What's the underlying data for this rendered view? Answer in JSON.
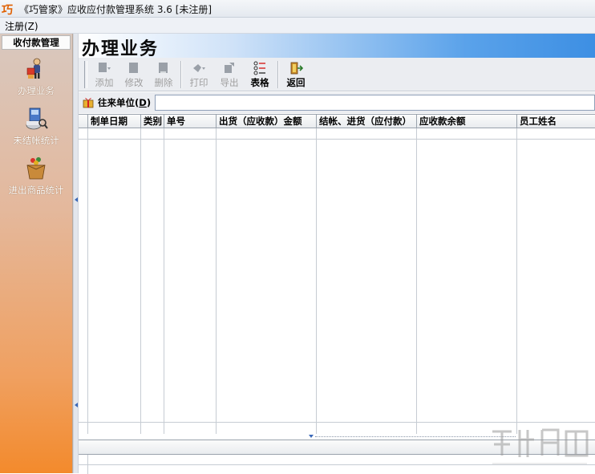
{
  "window": {
    "logo": "巧",
    "title": "《巧管家》应收应付款管理系统 3.6 [未注册]"
  },
  "menu": {
    "register": "注册(Z)"
  },
  "sidebar": {
    "header": "收付款管理",
    "items": [
      {
        "label": "办理业务",
        "icon": "business-person-icon"
      },
      {
        "label": "未结帐统计",
        "icon": "unsettled-stats-icon"
      },
      {
        "label": "进出商品统计",
        "icon": "goods-box-icon"
      }
    ]
  },
  "page": {
    "title": "办理业务"
  },
  "toolbar": {
    "add": "添加",
    "edit": "修改",
    "delete": "删除",
    "print": "打印",
    "export": "导出",
    "table": "表格",
    "back": "返回"
  },
  "filter": {
    "partner_label_main": "往来单位",
    "partner_label_key": "D",
    "partner_value": ""
  },
  "grid": {
    "columns": [
      "制单日期",
      "类别",
      "单号",
      "出货（应收款）金额",
      "结帐、进货（应付款）",
      "应收款余额",
      "员工姓名"
    ]
  },
  "colors": {
    "banner_gradient_end": "#3d8fe3",
    "sidebar_gradient_end": "#f38a2c",
    "accent_link": "#3a68b8"
  }
}
